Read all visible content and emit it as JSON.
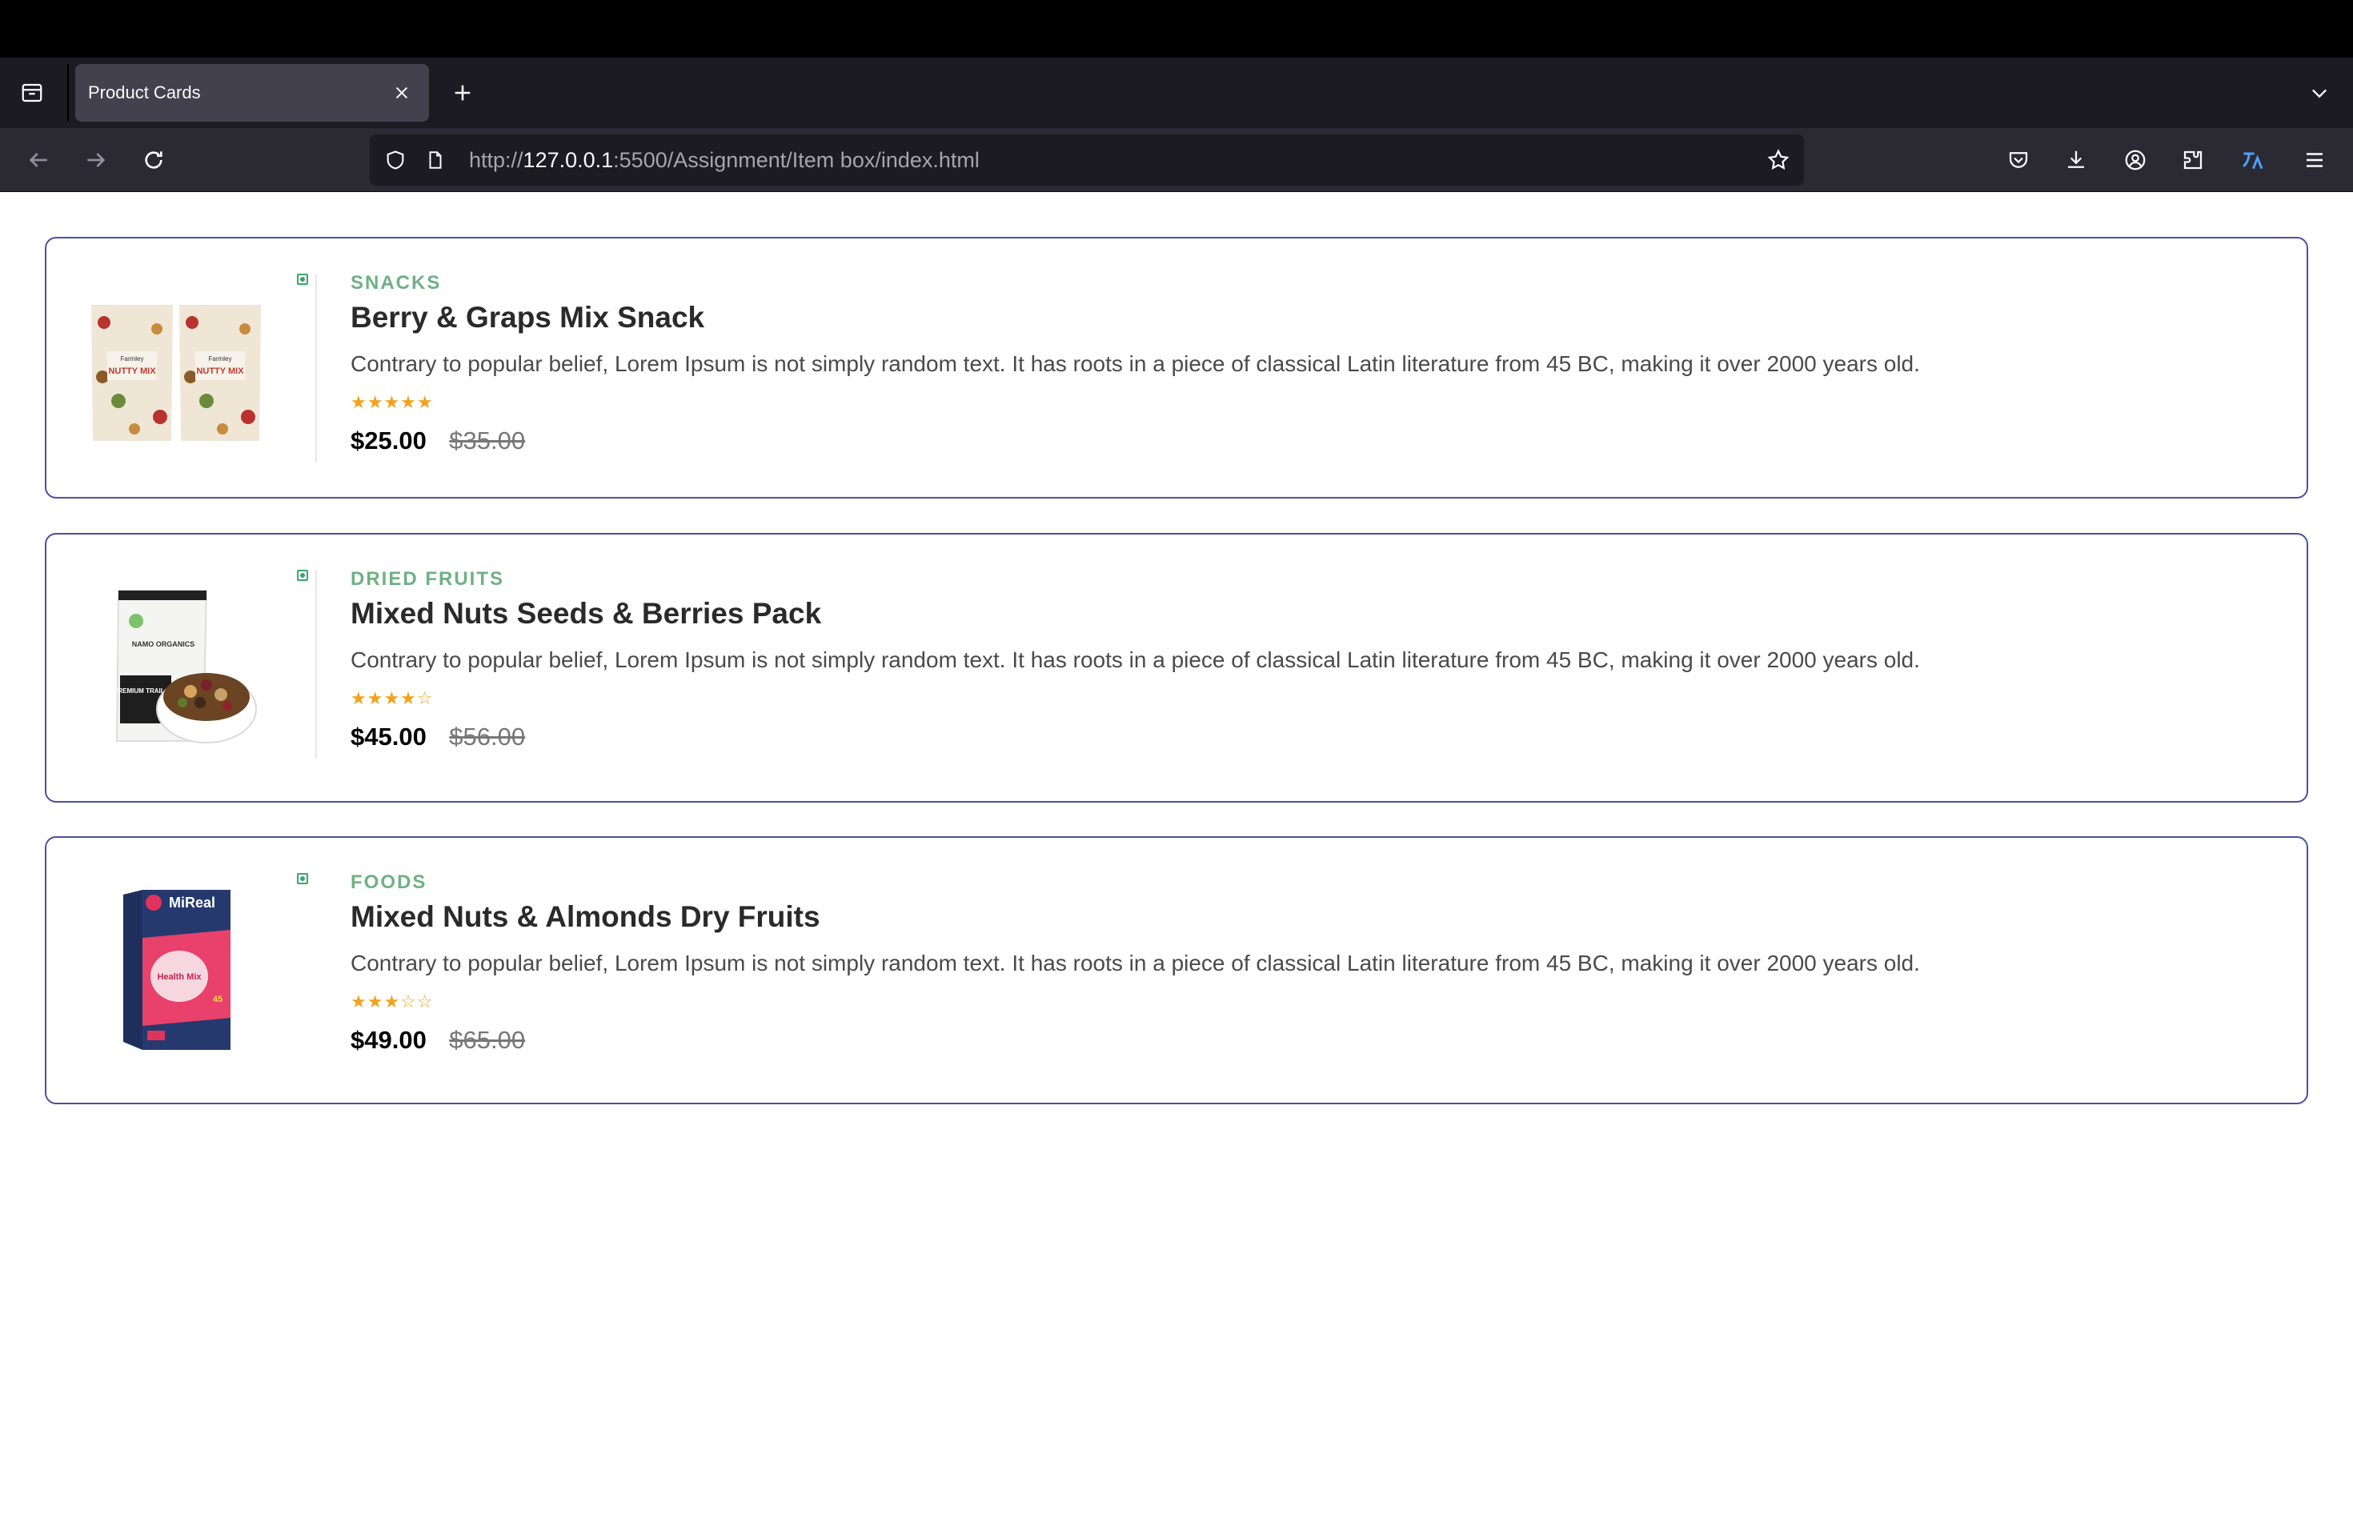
{
  "browser": {
    "tab_title": "Product Cards",
    "url_prefix": "http://",
    "url_host": "127.0.0.1",
    "url_rest": ":5500/Assignment/Item box/index.html"
  },
  "products": [
    {
      "category": "SNACKS",
      "title": "Berry & Graps Mix Snack",
      "description": "Contrary to popular belief, Lorem Ipsum is not simply random text. It has roots in a piece of classical Latin literature from 45 BC, making it over 2000 years old.",
      "stars": "★★★★★",
      "rating": 5,
      "price": "$25.00",
      "old_price": "$35.00",
      "package_brand": "Farmley",
      "package_label": "NUTTY MIX"
    },
    {
      "category": "DRIED FRUITS",
      "title": "Mixed Nuts Seeds & Berries Pack",
      "description": "Contrary to popular belief, Lorem Ipsum is not simply random text. It has roots in a piece of classical Latin literature from 45 BC, making it over 2000 years old.",
      "stars": "★★★★☆",
      "rating": 4,
      "price": "$45.00",
      "old_price": "$56.00",
      "package_brand": "NAMO ORGANICS",
      "package_label": "PREMIUM TRAIL MIX"
    },
    {
      "category": "FOODS",
      "title": "Mixed Nuts & Almonds Dry Fruits",
      "description": "Contrary to popular belief, Lorem Ipsum is not simply random text. It has roots in a piece of classical Latin literature from 45 BC, making it over 2000 years old.",
      "stars": "★★★☆☆",
      "rating": 3,
      "price": "$49.00",
      "old_price": "$65.00",
      "package_brand": "MiReal",
      "package_label": "Health Mix"
    }
  ],
  "colors": {
    "card_border": "#4b4fa3",
    "category": "#6fb183",
    "stars": "#f2a21b",
    "veg_mark": "#3aa56c"
  }
}
